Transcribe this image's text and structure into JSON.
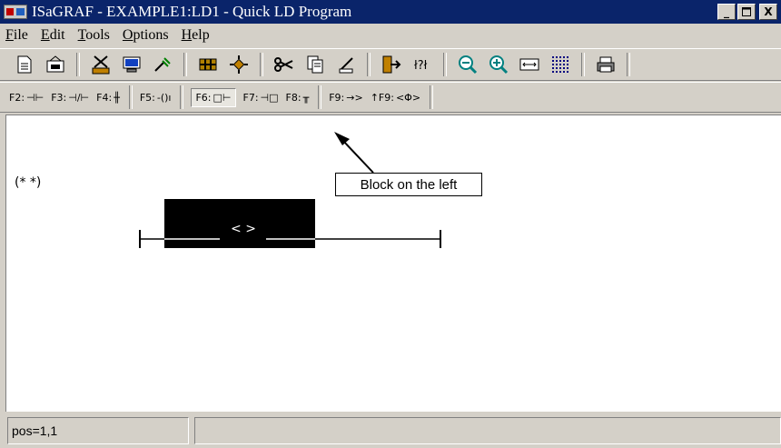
{
  "window": {
    "title": "ISaGRAF - EXAMPLE1:LD1 - Quick LD Program",
    "buttons": {
      "minimize": "_",
      "maximize": "□",
      "close": "X"
    }
  },
  "menu": [
    {
      "label": "File",
      "mnemonic": "F",
      "rest": "ile"
    },
    {
      "label": "Edit",
      "mnemonic": "E",
      "rest": "dit"
    },
    {
      "label": "Tools",
      "mnemonic": "T",
      "rest": "ools"
    },
    {
      "label": "Options",
      "mnemonic": "O",
      "rest": "ptions"
    },
    {
      "label": "Help",
      "mnemonic": "H",
      "rest": "elp"
    }
  ],
  "toolbar_icons": [
    "new-document-icon",
    "open-icon",
    "cut-variables-icon",
    "monitor-icon",
    "wand-icon",
    "grid-table-icon",
    "network-icon",
    "scissors-icon",
    "copy-icon",
    "paste-icon",
    "goto-icon",
    "find-icon",
    "zoom-out-icon",
    "zoom-in-icon",
    "resize-icon",
    "grid-dots-icon",
    "print-icon"
  ],
  "function_keys": [
    {
      "key": "F2:",
      "symbol": "⊣⊢",
      "group": 1
    },
    {
      "key": "F3:",
      "symbol": "⊣/⊢",
      "group": 1
    },
    {
      "key": "F4:",
      "symbol": "╫",
      "group": 1
    },
    {
      "key": "F5:",
      "symbol": "-()ı",
      "group": 2
    },
    {
      "key": "F6:",
      "symbol": "□⊢",
      "group": 3,
      "pressed": true
    },
    {
      "key": "F7:",
      "symbol": "⊣□",
      "group": 3
    },
    {
      "key": "F8:",
      "symbol": "╥",
      "group": 3
    },
    {
      "key": "F9:",
      "symbol": "→>",
      "group": 4
    },
    {
      "key": "↑F9:",
      "symbol": "<Φ>",
      "group": 4
    }
  ],
  "editor": {
    "comment": "(* *)",
    "callout": "Block on the left",
    "contact_label": "< >"
  },
  "status": {
    "position": "pos=1,1",
    "message": ""
  },
  "colors": {
    "titlebar": "#0a246a",
    "face": "#d4d0c8",
    "editor_bg": "#ffffff",
    "block": "#000000"
  }
}
